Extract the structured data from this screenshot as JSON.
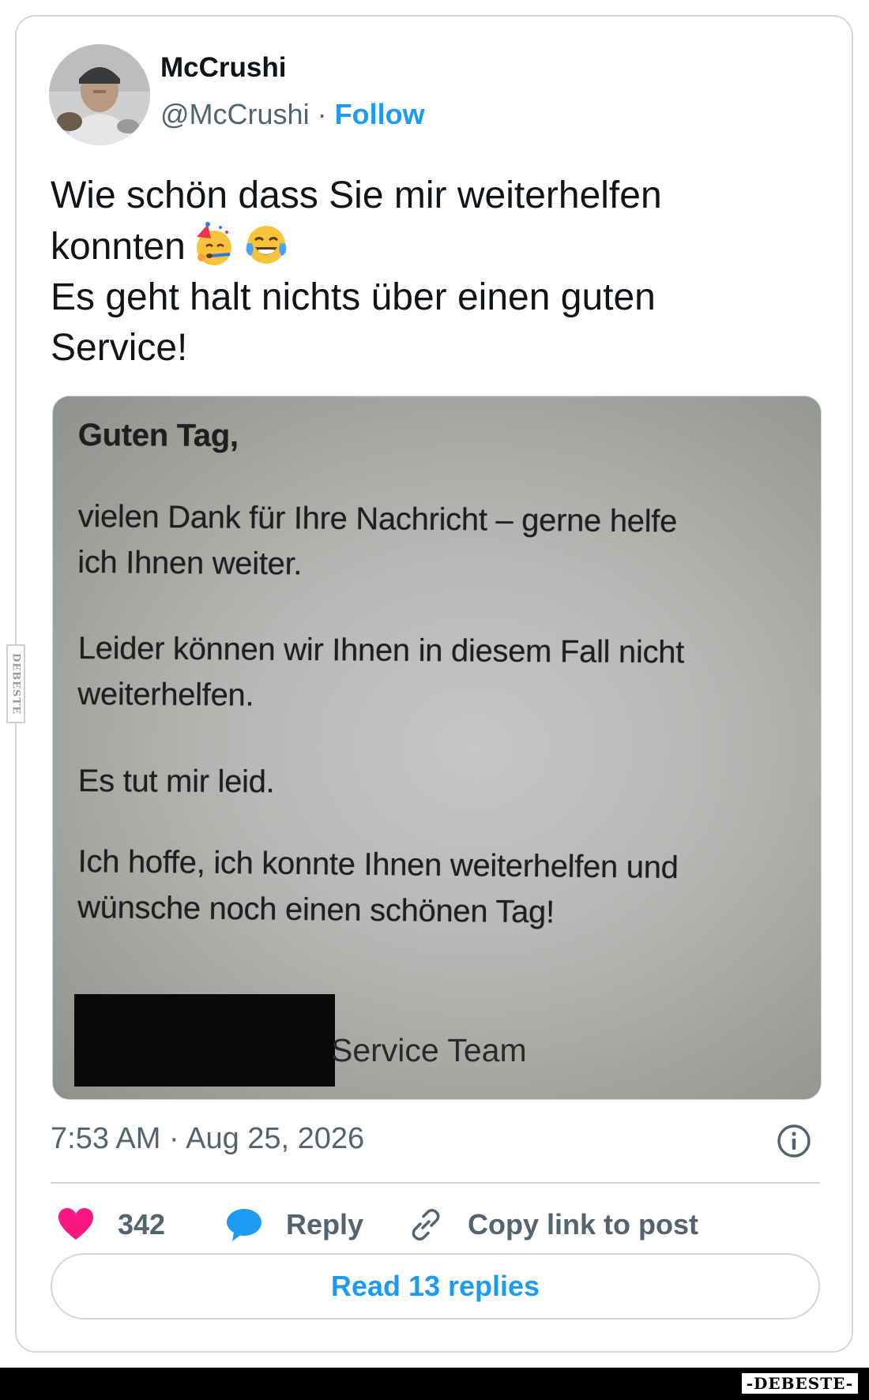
{
  "author": {
    "name": "McCrushi",
    "handle": "@McCrushi",
    "separator": "·",
    "follow_label": "Follow"
  },
  "tweet": {
    "line1": "Wie schön dass Sie mir weiterhelfen",
    "line2": "konnten",
    "line2_emojis": [
      "partying-face-emoji",
      "tears-of-joy-emoji"
    ],
    "line3": "Es geht halt nichts über einen guten",
    "line4": "Service!"
  },
  "media": {
    "greeting": "Guten Tag,",
    "p1_line1": "vielen Dank für Ihre Nachricht – gerne helfe",
    "p1_line2": "ich Ihnen weiter.",
    "p2_line1": "Leider können wir Ihnen in diesem Fall nicht",
    "p2_line2": "weiterhelfen.",
    "p3": "Es tut mir leid.",
    "p4_line1": "Ich hoffe, ich konnte Ihnen weiterhelfen und",
    "p4_line2": "wünsche noch einen schönen Tag!",
    "signature": "Service Team"
  },
  "meta": {
    "timestamp": "7:53 AM · Aug 25, 2026",
    "info_icon": "info-icon"
  },
  "actions": {
    "like_count": "342",
    "reply_label": "Reply",
    "copy_label": "Copy link to post",
    "read_replies_label": "Read 13 replies"
  },
  "watermark": {
    "side_text": "DEBESTE",
    "bottom_text": "-DEBESTE-"
  },
  "colors": {
    "accent": "#1d9bf0",
    "like": "#f91880",
    "muted": "#536471",
    "border": "#cfd9de"
  }
}
